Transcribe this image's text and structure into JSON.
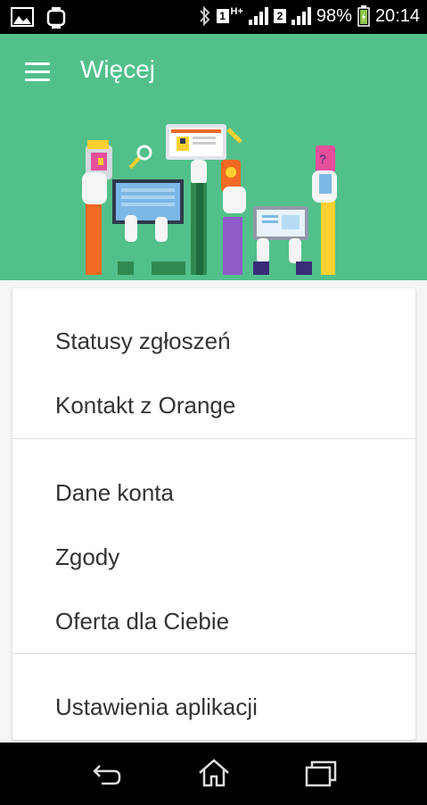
{
  "status_bar": {
    "sim1": "1",
    "sim2": "2",
    "network": "H+",
    "battery": "98%",
    "time": "20:14"
  },
  "header": {
    "title": "Więcej",
    "background_color": "#52c08a"
  },
  "menu": {
    "group1": [
      {
        "label": "Statusy zgłoszeń"
      },
      {
        "label": "Kontakt z Orange"
      }
    ],
    "group2": [
      {
        "label": "Dane konta"
      },
      {
        "label": "Zgody"
      },
      {
        "label": "Oferta dla Ciebie"
      }
    ],
    "group3": [
      {
        "label": "Ustawienia aplikacji"
      }
    ]
  },
  "navigation": {
    "icons": [
      "back-icon",
      "home-icon",
      "recent-apps-icon"
    ]
  }
}
